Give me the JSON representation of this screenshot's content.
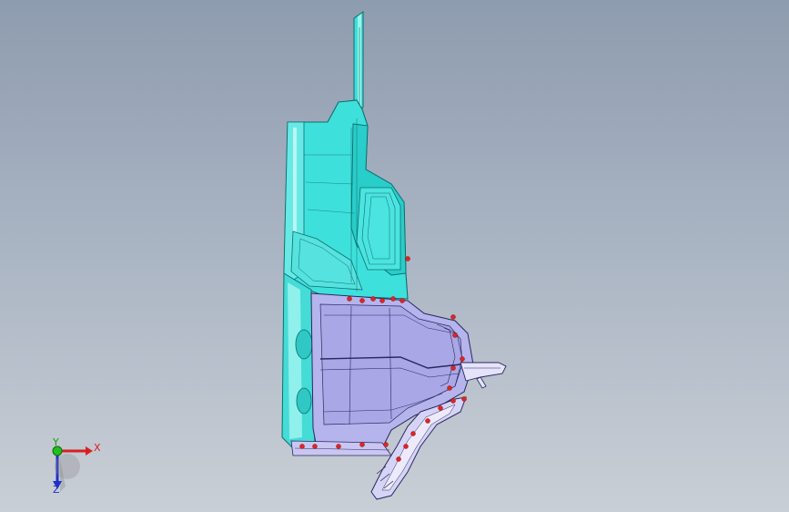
{
  "viewport": {
    "background_top": "#8e9caf",
    "background_bottom": "#c9cfd6"
  },
  "model": {
    "name": "",
    "colors": {
      "shell": "#3ee0dc",
      "shell_light": "#9ff2ef",
      "shell_edge": "#0c6f6e",
      "lower_body": "#b6b4ec",
      "lower_body_dark": "#8f8cd4",
      "lower_edge": "#2b2860",
      "weld_point": "#e02424"
    }
  },
  "triad": {
    "x_label": "X",
    "y_label": "Y",
    "z_label": "Z",
    "x_color": "#d92020",
    "y_color": "#1a9a1a",
    "z_color": "#2030c8"
  }
}
